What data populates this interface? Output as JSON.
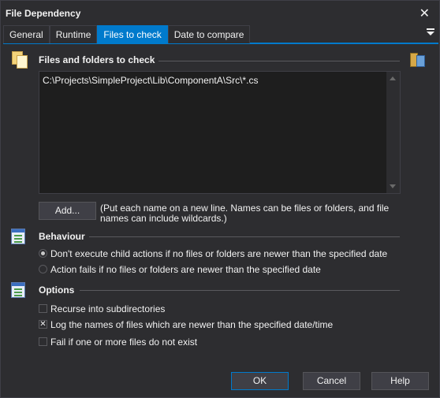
{
  "window": {
    "title": "File Dependency",
    "close_glyph": "✕"
  },
  "tabs": [
    {
      "label": "General"
    },
    {
      "label": "Runtime"
    },
    {
      "label": "Files to check",
      "active": true
    },
    {
      "label": "Date to compare"
    }
  ],
  "files_section": {
    "title": "Files and folders to check",
    "editor_value": "C:\\Projects\\SimpleProject\\Lib\\ComponentA\\Src\\*.cs",
    "add_button": "Add...",
    "hint": "(Put each name on a new line. Names can be files or folders, and file names can include wildcards.)"
  },
  "behaviour_section": {
    "title": "Behaviour",
    "options": [
      {
        "label": "Don't execute child actions if no files or folders are newer than the specified date",
        "checked": true
      },
      {
        "label": "Action fails if no files or folders are newer than the specified date",
        "checked": false
      }
    ]
  },
  "options_section": {
    "title": "Options",
    "checkboxes": [
      {
        "label": "Recurse into subdirectories",
        "checked": false
      },
      {
        "label": "Log the names of files which are newer than the specified date/time",
        "checked": true
      },
      {
        "label": "Fail if one or more files do not exist",
        "checked": false
      }
    ]
  },
  "footer": {
    "ok": "OK",
    "cancel": "Cancel",
    "help": "Help"
  },
  "colors": {
    "accent": "#007acc",
    "background": "#2d2d30",
    "editor_bg": "#1e1e1e"
  },
  "icons": {
    "files_section": "folder-files-icon",
    "behaviour_section": "list-settings-icon",
    "options_section": "list-settings-icon",
    "extra": "variables-icon"
  }
}
